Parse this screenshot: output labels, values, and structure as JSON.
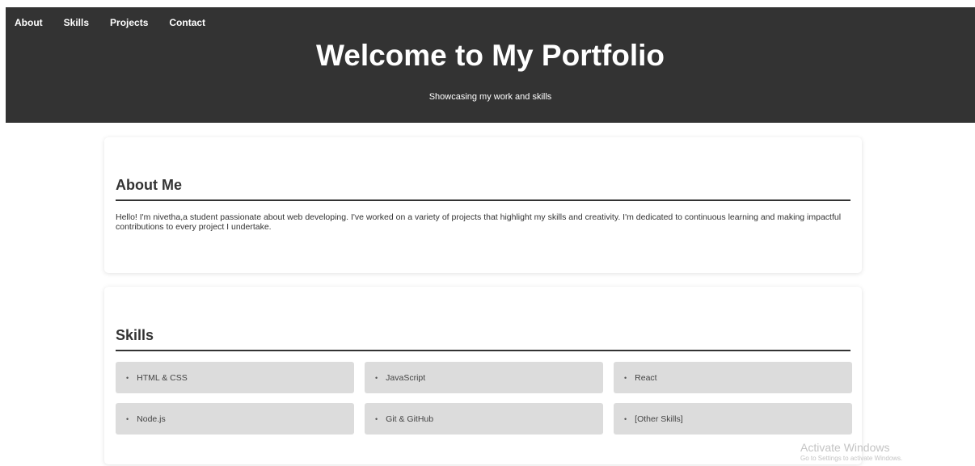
{
  "nav": {
    "items": [
      "About",
      "Skills",
      "Projects",
      "Contact"
    ]
  },
  "header": {
    "title": "Welcome to My Portfolio",
    "tagline": "Showcasing my work and skills"
  },
  "about": {
    "heading": "About Me",
    "text": "Hello! I'm nivetha,a student passionate about web developing. I've worked on a variety of projects that highlight my skills and creativity. I'm dedicated to continuous learning and making impactful contributions to every project I undertake."
  },
  "skills": {
    "heading": "Skills",
    "items": [
      "HTML & CSS",
      "JavaScript",
      "React",
      "Node.js",
      "Git & GitHub",
      "[Other Skills]"
    ]
  },
  "watermark": {
    "title": "Activate Windows",
    "subtitle": "Go to Settings to activate Windows."
  },
  "colors": {
    "header_bg": "#333333",
    "skill_bg": "#dcdcdc",
    "text": "#333333"
  }
}
